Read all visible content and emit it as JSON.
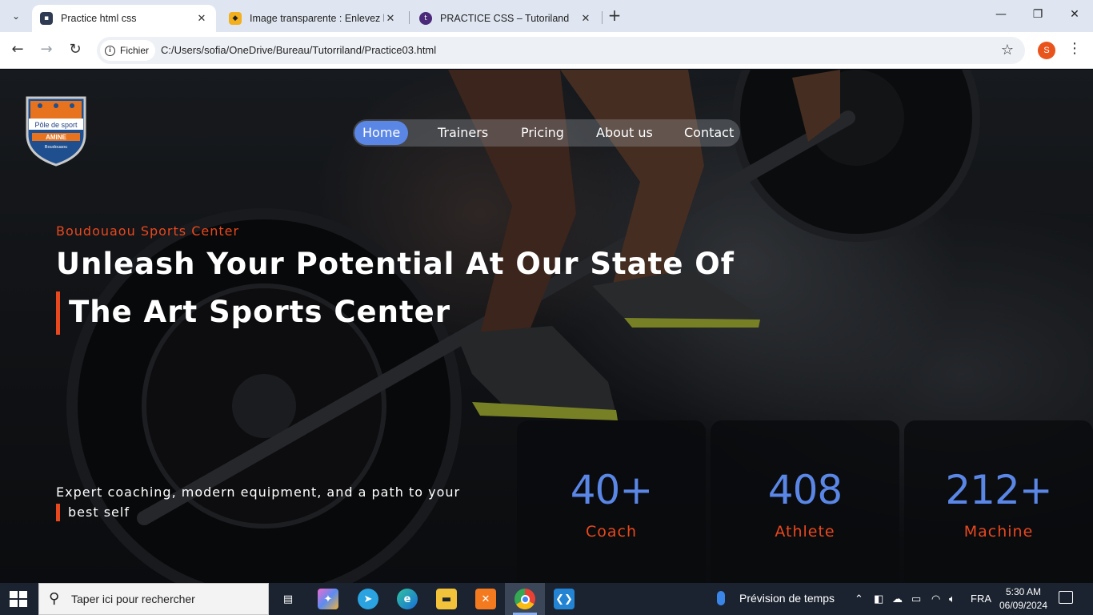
{
  "browser": {
    "tabs": [
      {
        "title": "Practice html css",
        "active": true
      },
      {
        "title": "Image transparente : Enlevez le",
        "active": false
      },
      {
        "title": "PRACTICE CSS – Tutoriland",
        "active": false
      }
    ],
    "new_tab": "+",
    "close_glyph": "✕",
    "security_chip": "Fichier",
    "url": "C:/Users/sofia/OneDrive/Bureau/Tutorriland/Practice03.html",
    "profile_initial": "S"
  },
  "site": {
    "logo": {
      "line1": "Pôle de sport",
      "line2": "AMINE",
      "line3": "Boudouaou"
    },
    "nav": {
      "items": [
        "Home",
        "Trainers",
        "Pricing",
        "About us",
        "Contact"
      ],
      "active": "Home"
    },
    "hero": {
      "eyebrow": "Boudouaou Sports Center",
      "title_line1": "Unleash Your Potential At Our State Of",
      "title_line2": "The Art Sports Center",
      "tagline_line1": "Expert coaching, modern equipment, and a path to your",
      "tagline_line2": "best self"
    },
    "stats": [
      {
        "value": "40+",
        "label": "Coach"
      },
      {
        "value": "408",
        "label": "Athlete"
      },
      {
        "value": "212+",
        "label": "Machine"
      }
    ],
    "colors": {
      "accent": "#e8481e",
      "primary": "#5a86e6"
    }
  },
  "taskbar": {
    "search_placeholder": "Taper ici pour rechercher",
    "weather": "Prévision de temps",
    "language": "FRA",
    "time": "5:30 AM",
    "date": "06/09/2024",
    "pinned_icons": [
      "task-view-icon",
      "copilot-icon",
      "telegram-icon",
      "edge-icon",
      "file-explorer-icon",
      "xampp-icon",
      "chrome-icon",
      "vscode-icon"
    ]
  }
}
